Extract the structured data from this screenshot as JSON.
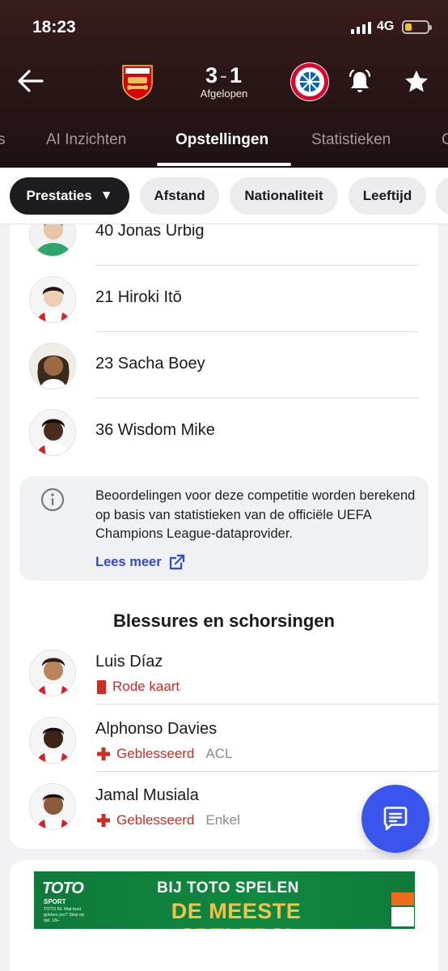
{
  "status_bar": {
    "time": "18:23",
    "network": "4G",
    "battery_level": 0.25
  },
  "match": {
    "home_team": "Arsenal",
    "away_team": "FC Bayern München",
    "score_home": "3",
    "score_away": "1",
    "status": "Afgelopen"
  },
  "tabs": [
    {
      "label": "s"
    },
    {
      "label": "AI Inzichten"
    },
    {
      "label": "Opstellingen"
    },
    {
      "label": "Statistieken"
    },
    {
      "label": "C"
    }
  ],
  "active_tab": "Opstellingen",
  "filters": [
    {
      "label": "Prestaties",
      "active": true
    },
    {
      "label": "Afstand"
    },
    {
      "label": "Nationaliteit"
    },
    {
      "label": "Leeftijd"
    }
  ],
  "players": [
    {
      "number": "40",
      "name": "Jonas Urbig",
      "display": "40 Jonas Urbig"
    },
    {
      "number": "21",
      "name": "Hiroki Itō",
      "display": "21 Hiroki Itō"
    },
    {
      "number": "23",
      "name": "Sacha Boey",
      "display": "23 Sacha Boey"
    },
    {
      "number": "36",
      "name": "Wisdom Mike",
      "display": "36 Wisdom Mike"
    }
  ],
  "info_box": {
    "text": "Beoordelingen voor deze competitie worden berekend op basis van statistieken van de officiële UEFA Champions League-dataprovider.",
    "link": "Lees meer"
  },
  "injuries_section": {
    "title": "Blessures en schorsingen",
    "items": [
      {
        "name": "Luis Díaz",
        "reason": "Rode kaart",
        "detail": ""
      },
      {
        "name": "Alphonso Davies",
        "reason": "Geblesseerd",
        "detail": "ACL"
      },
      {
        "name": "Jamal Musiala",
        "reason": "Geblesseerd",
        "detail": "Enkel"
      }
    ]
  },
  "ad": {
    "brand": "TOTO",
    "brand_sub": "SPORT",
    "small_text": "TOTO.NL Wat kost gokken jou? Stop op tijd. 18+",
    "line1": "BIJ TOTO SPELEN",
    "line2": "DE MEESTE SPELERS!"
  },
  "colors": {
    "header_bg": "#2b1616",
    "accent_blue": "#3a55ee",
    "link_blue": "#3548d4",
    "injury_red": "#c93024",
    "ad_green": "#11883f",
    "ad_gold": "#f2c14a"
  }
}
